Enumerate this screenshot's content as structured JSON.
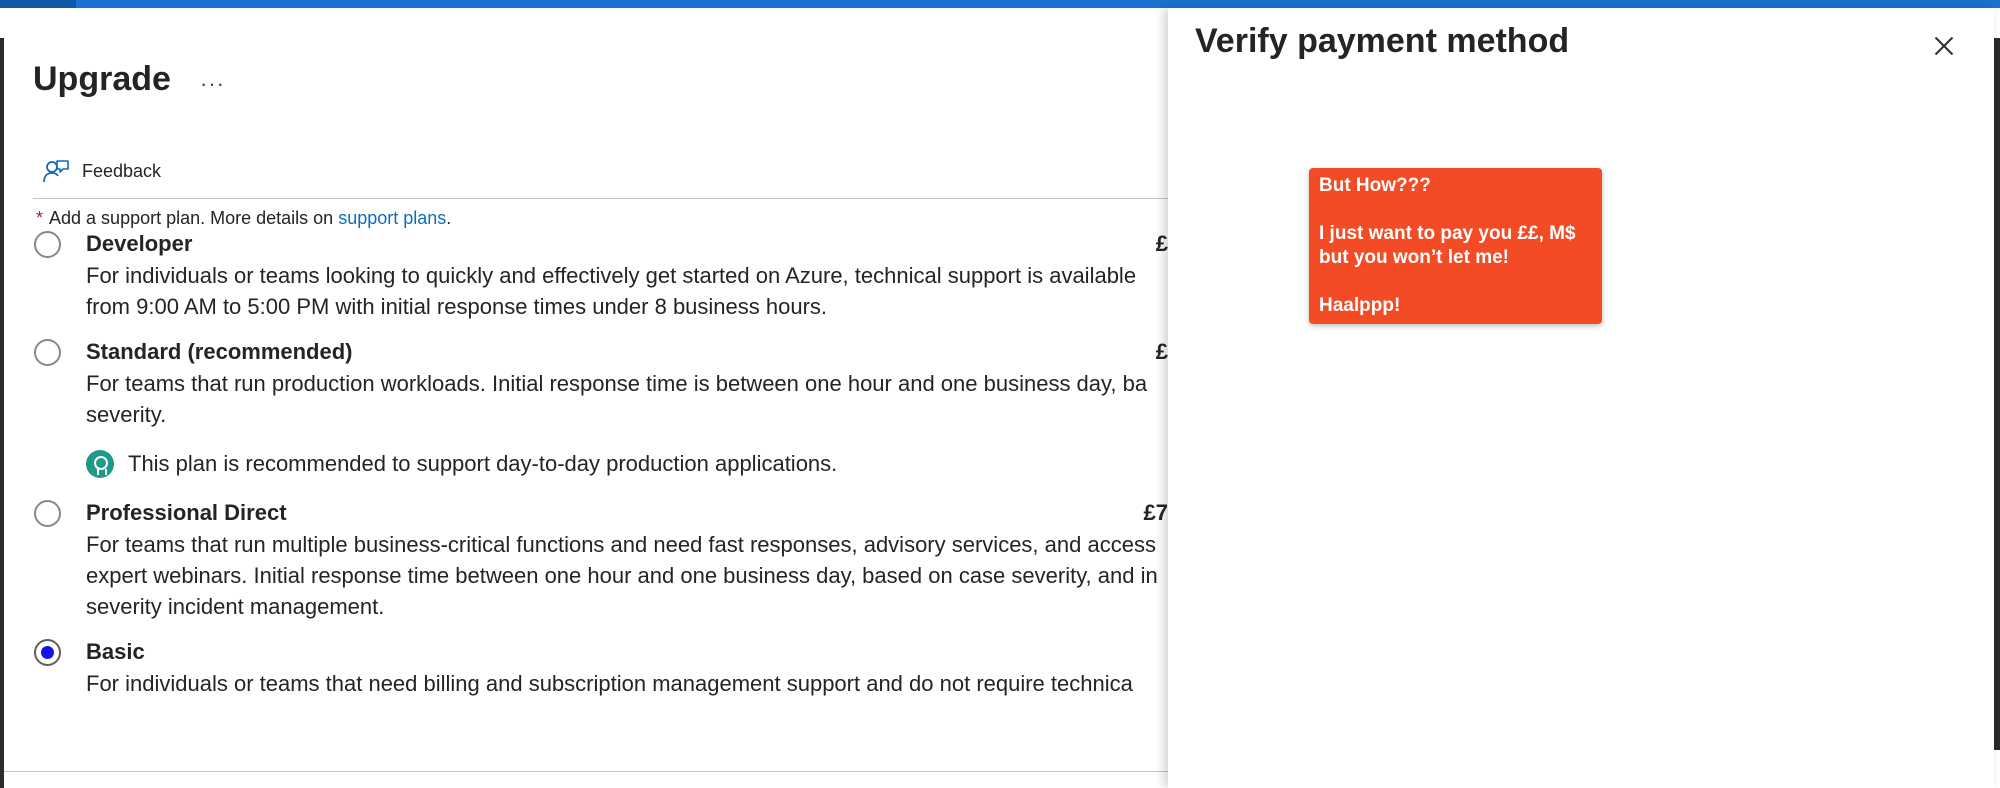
{
  "main": {
    "title": "Upgrade",
    "more_label": "···",
    "feedback_label": "Feedback",
    "support_note": {
      "required_mark": "*",
      "prefix": "Add a support plan. More details on ",
      "link_text": "support plans",
      "suffix": "."
    },
    "plans": [
      {
        "name": "Developer",
        "price": "£",
        "selected": false,
        "description": "For individuals or teams looking to quickly and effectively get started on Azure, technical support is available\nfrom 9:00 AM to 5:00 PM with initial response times under 8 business hours."
      },
      {
        "name": "Standard (recommended)",
        "price": "£",
        "selected": false,
        "description": "For teams that run production workloads. Initial response time is between one hour and one business day, ba\nseverity.",
        "recommendation": "This plan is recommended to support day-to-day production applications."
      },
      {
        "name": "Professional Direct",
        "price": "£7",
        "selected": false,
        "description": "For teams that run multiple business-critical functions and need fast responses, advisory services, and access\nexpert webinars. Initial response time between one hour and one business day, based on case severity, and in\nseverity incident management."
      },
      {
        "name": "Basic",
        "price": "",
        "selected": true,
        "description": "For individuals or teams that need billing and subscription management support and do not require technica"
      }
    ]
  },
  "panel": {
    "title": "Verify payment method",
    "note": {
      "line1": "But How???",
      "line2": "I just want to pay you ££, M$",
      "line3": "but you won’t let me!",
      "line4": "Haalppp!"
    }
  },
  "colors": {
    "accent_bar": "#1a73d0",
    "link": "#0f6cbd",
    "radio_selected": "#1414e6",
    "note_bg": "#f24b25",
    "recommend_icon": "#1f9a8a"
  }
}
